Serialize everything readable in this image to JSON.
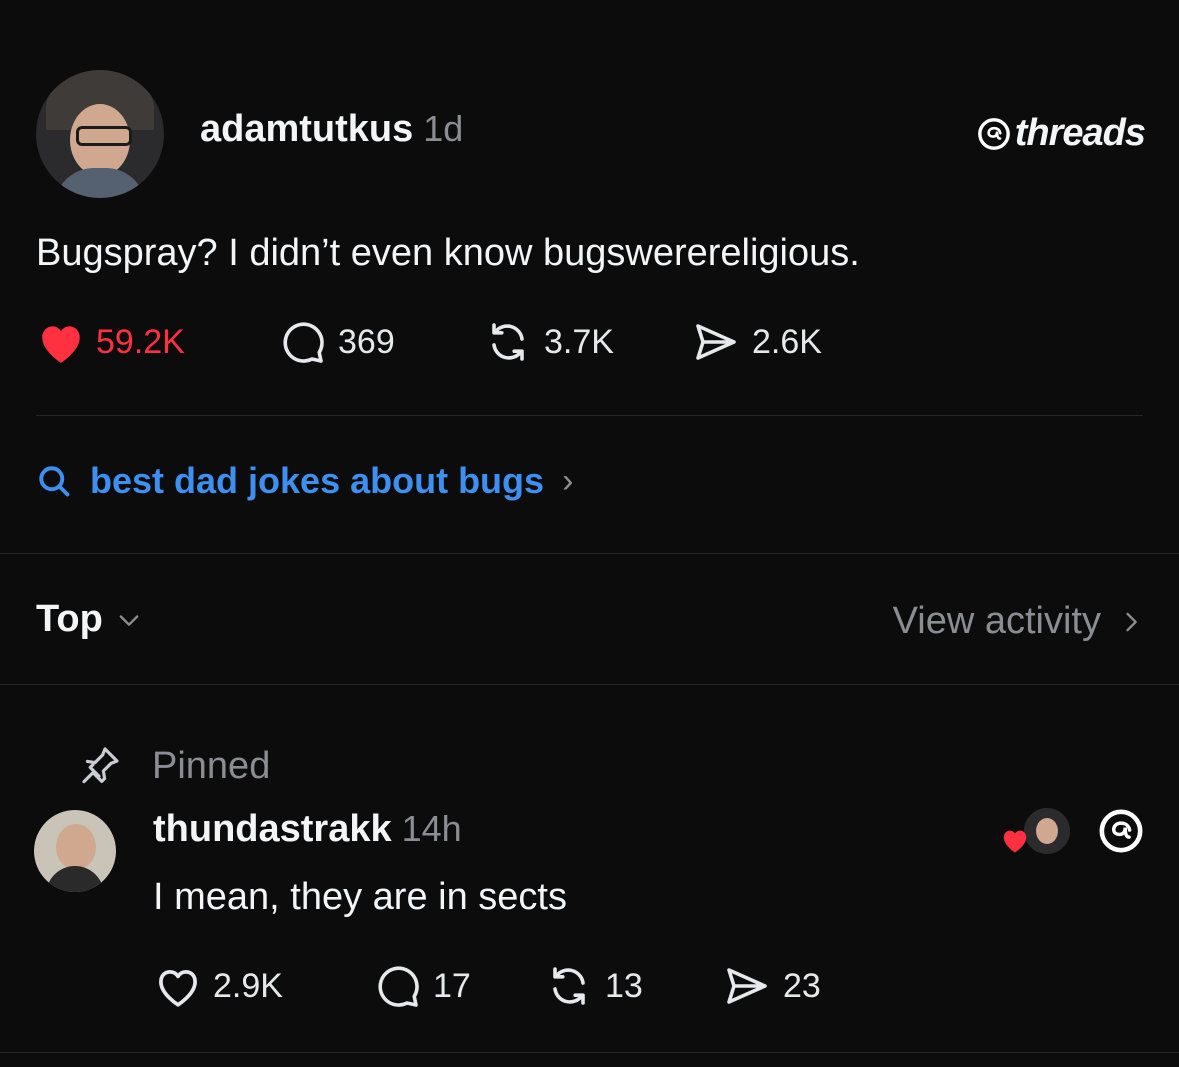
{
  "brand": {
    "logo_text": "threads"
  },
  "post": {
    "username": "adamtutkus",
    "time": "1d",
    "text": "Bugspray? I didn’t even know bugswerereligious.",
    "stats": {
      "likes": "59.2K",
      "replies": "369",
      "reposts": "3.7K",
      "shares": "2.6K"
    },
    "like_color": "#ff3040"
  },
  "search_suggestion": {
    "text": "best dad jokes about bugs"
  },
  "sort": {
    "label": "Top",
    "view_activity": "View activity"
  },
  "reply": {
    "pinned_label": "Pinned",
    "username": "thundastrakk",
    "time": "14h",
    "text": "I mean, they are in sects",
    "stats": {
      "likes": "2.9K",
      "replies": "17",
      "reposts": "13",
      "shares": "23"
    }
  },
  "colors": {
    "accent": "#3d8ff0",
    "background": "#0c0c0d",
    "muted": "#8a8d91"
  }
}
